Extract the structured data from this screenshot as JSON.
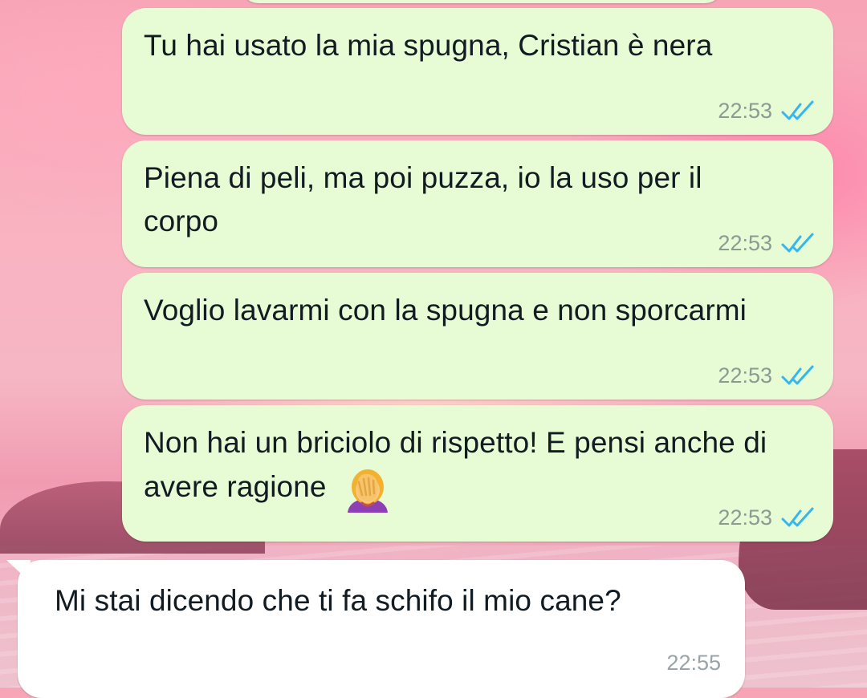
{
  "colors": {
    "outgoing_bubble": "#e7fbd5",
    "incoming_bubble": "#ffffff",
    "read_check": "#34b7f1"
  },
  "messages": [
    {
      "direction": "outgoing",
      "text": "Tu hai usato la mia spugna, Cristian è nera",
      "time": "22:53",
      "status_icon": "double-check-read-icon"
    },
    {
      "direction": "outgoing",
      "text": "Piena di peli, ma poi puzza, io la uso per il corpo",
      "time": "22:53",
      "status_icon": "double-check-read-icon"
    },
    {
      "direction": "outgoing",
      "text": "Voglio lavarmi con la spugna e non sporcarmi",
      "time": "22:53",
      "status_icon": "double-check-read-icon"
    },
    {
      "direction": "outgoing",
      "text": "Non hai un briciolo di rispetto! E pensi anche di avere ragione",
      "emoji": "woman-facepalming-emoji",
      "time": "22:53",
      "status_icon": "double-check-read-icon"
    },
    {
      "direction": "incoming",
      "text": "Mi stai dicendo che ti fa schifo il mio cane?",
      "time": "22:55"
    }
  ]
}
